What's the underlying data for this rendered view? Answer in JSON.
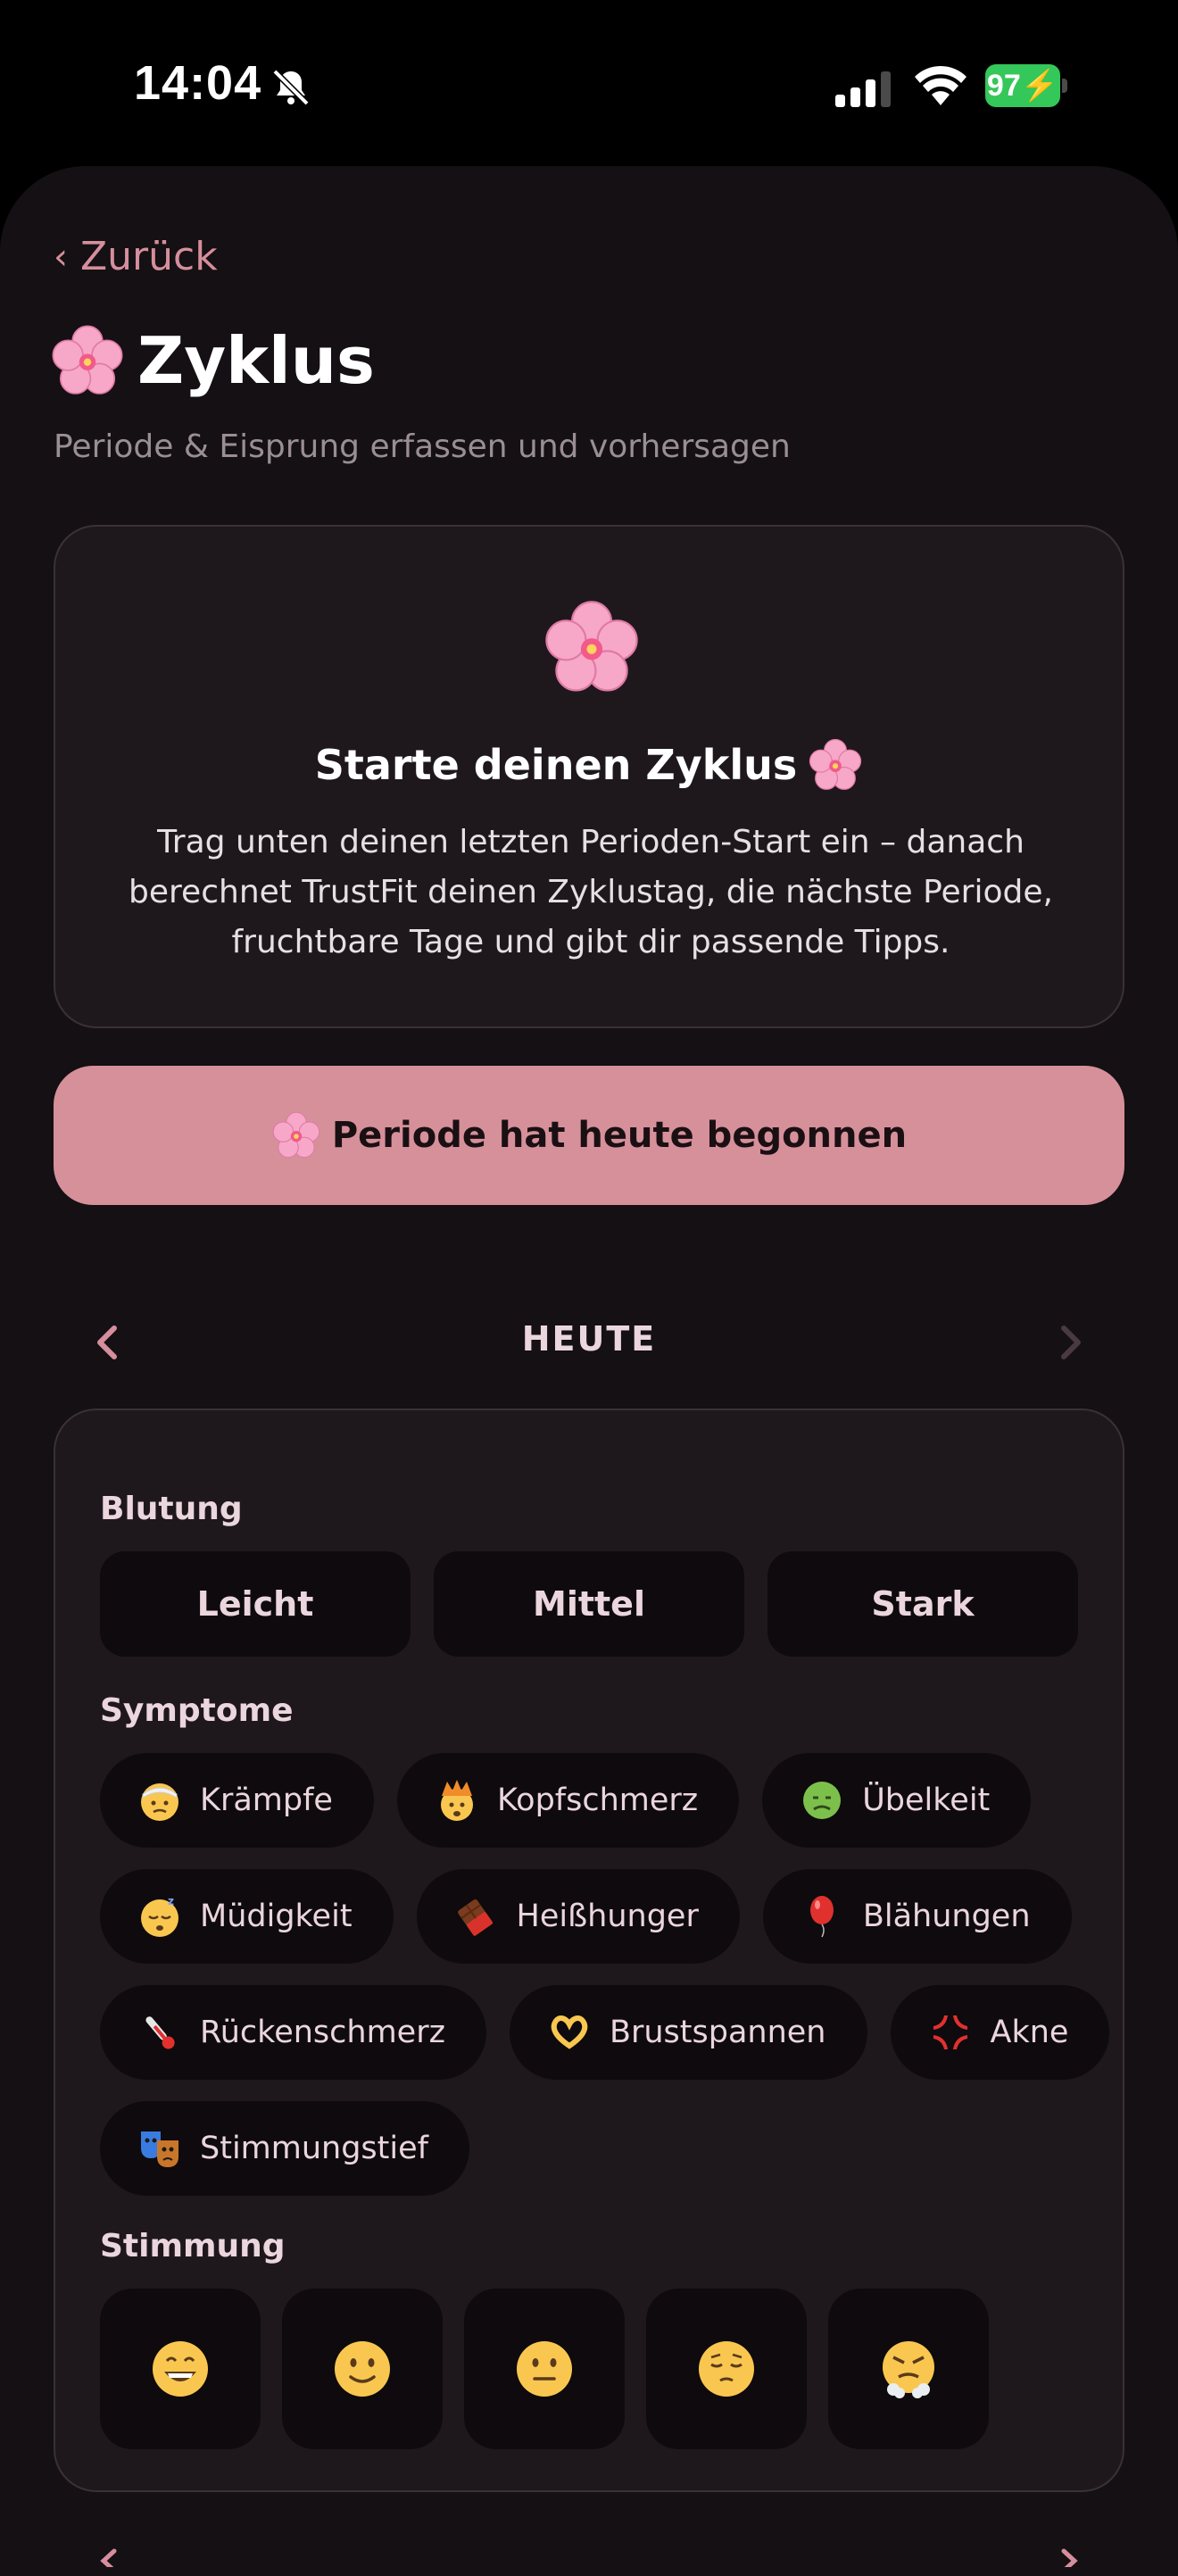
{
  "status": {
    "time": "14:04",
    "battery": "97",
    "icons": [
      "bell-slash-icon",
      "signal-icon",
      "wifi-icon",
      "battery-charging-icon"
    ]
  },
  "nav": {
    "back_label": "Zurück"
  },
  "header": {
    "title": "Zyklus",
    "subtitle": "Periode & Eisprung erfassen und vorhersagen"
  },
  "intro": {
    "heading": "Starte deinen Zyklus",
    "text": "Trag unten deinen letzten Perioden-Start ein – danach berechnet TrustFit deinen Zyklustag, die nächste Periode, fruchtbare Tage und gibt dir passende Tipps."
  },
  "period_button": {
    "label": "Periode hat heute begonnen"
  },
  "day_nav": {
    "label": "HEUTE"
  },
  "log": {
    "flow_label": "Blutung",
    "flow_options": [
      "Leicht",
      "Mittel",
      "Stark"
    ],
    "symptoms_label": "Symptome",
    "symptoms": [
      {
        "label": "Krämpfe",
        "icon": "bandaged-face-icon"
      },
      {
        "label": "Kopfschmerz",
        "icon": "exploding-head-icon"
      },
      {
        "label": "Übelkeit",
        "icon": "nauseated-face-icon"
      },
      {
        "label": "Müdigkeit",
        "icon": "sleeping-face-icon"
      },
      {
        "label": "Heißhunger",
        "icon": "chocolate-bar-icon"
      },
      {
        "label": "Blähungen",
        "icon": "balloon-icon"
      },
      {
        "label": "Rückenschmerz",
        "icon": "thermometer-icon"
      },
      {
        "label": "Brustspannen",
        "icon": "heart-hands-icon"
      },
      {
        "label": "Akne",
        "icon": "anger-symbol-icon"
      },
      {
        "label": "Stimmungstief",
        "icon": "performing-arts-icon"
      }
    ],
    "mood_label": "Stimmung",
    "moods": [
      "grinning-face-icon",
      "slightly-smiling-face-icon",
      "neutral-face-icon",
      "pensive-face-icon",
      "huffing-face-icon"
    ]
  },
  "colors": {
    "accent": "#d6909a",
    "background": "#141013",
    "card": "#1e181c",
    "chip": "#0e0a0d",
    "battery": "#34c759"
  }
}
